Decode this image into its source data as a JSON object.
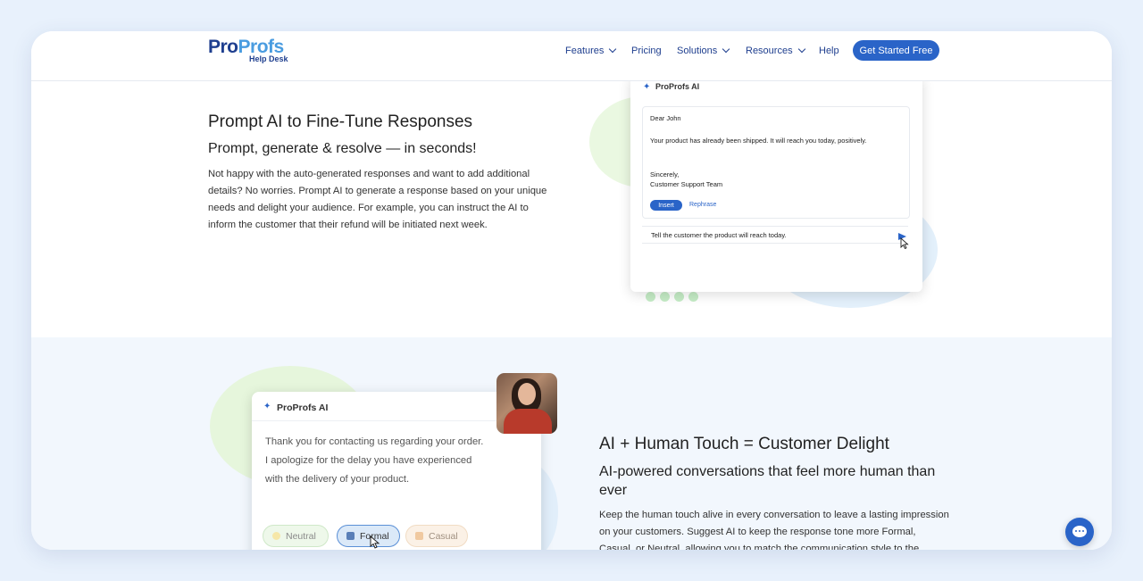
{
  "header": {
    "logo": {
      "pro": "Pro",
      "profs": "Profs",
      "subtitle": "Help Desk"
    },
    "nav": [
      {
        "label": "Features",
        "dropdown": true
      },
      {
        "label": "Pricing",
        "dropdown": false
      },
      {
        "label": "Solutions",
        "dropdown": true
      },
      {
        "label": "Resources",
        "dropdown": true
      },
      {
        "label": "Help",
        "dropdown": false
      }
    ],
    "cta_label": "Get Started Free"
  },
  "section1": {
    "title": "Prompt AI to Fine-Tune Responses",
    "subtitle": "Prompt, generate & resolve — in seconds!",
    "body": "Not happy with the auto-generated responses and want to add additional details? No worries. Prompt AI to generate a response based on your unique needs and delight your audience. For example, you can instruct the AI to inform the customer that their refund will be initiated next week.",
    "card": {
      "title": "ProProfs AI",
      "greeting": "Dear John",
      "message": "Your product has already been shipped. It will reach you today, positively.",
      "signoff": "Sincerely,",
      "signature": "Customer Support Team",
      "insert_label": "Insert",
      "rephrase_label": "Rephrase",
      "prompt_text": "Tell the customer the product will reach today."
    }
  },
  "section2": {
    "title": "AI + Human Touch = Customer Delight",
    "subtitle": "AI-powered conversations that feel more human than ever",
    "body": "Keep the human touch alive in every conversation to leave a lasting impression on your customers. Suggest AI to keep the response tone more Formal, Casual, or Neutral, allowing you to match the communication style to the customer's expectations for a tailored interaction every time.",
    "card": {
      "title": "ProProfs AI",
      "message": "Thank you for contacting us regarding your order. I apologize for the delay you have experienced with the delivery of your product.",
      "tones": [
        {
          "label": "Neutral",
          "color": "#f6e7a8"
        },
        {
          "label": "Formal",
          "color": "#5a7fb8"
        },
        {
          "label": "Casual",
          "color": "#f0c9a0"
        }
      ],
      "selected_tone": "Formal"
    }
  },
  "colors": {
    "brand_dark": "#1f3f8f",
    "brand_blue": "#2a64c8",
    "brand_light": "#4a9ce0"
  }
}
